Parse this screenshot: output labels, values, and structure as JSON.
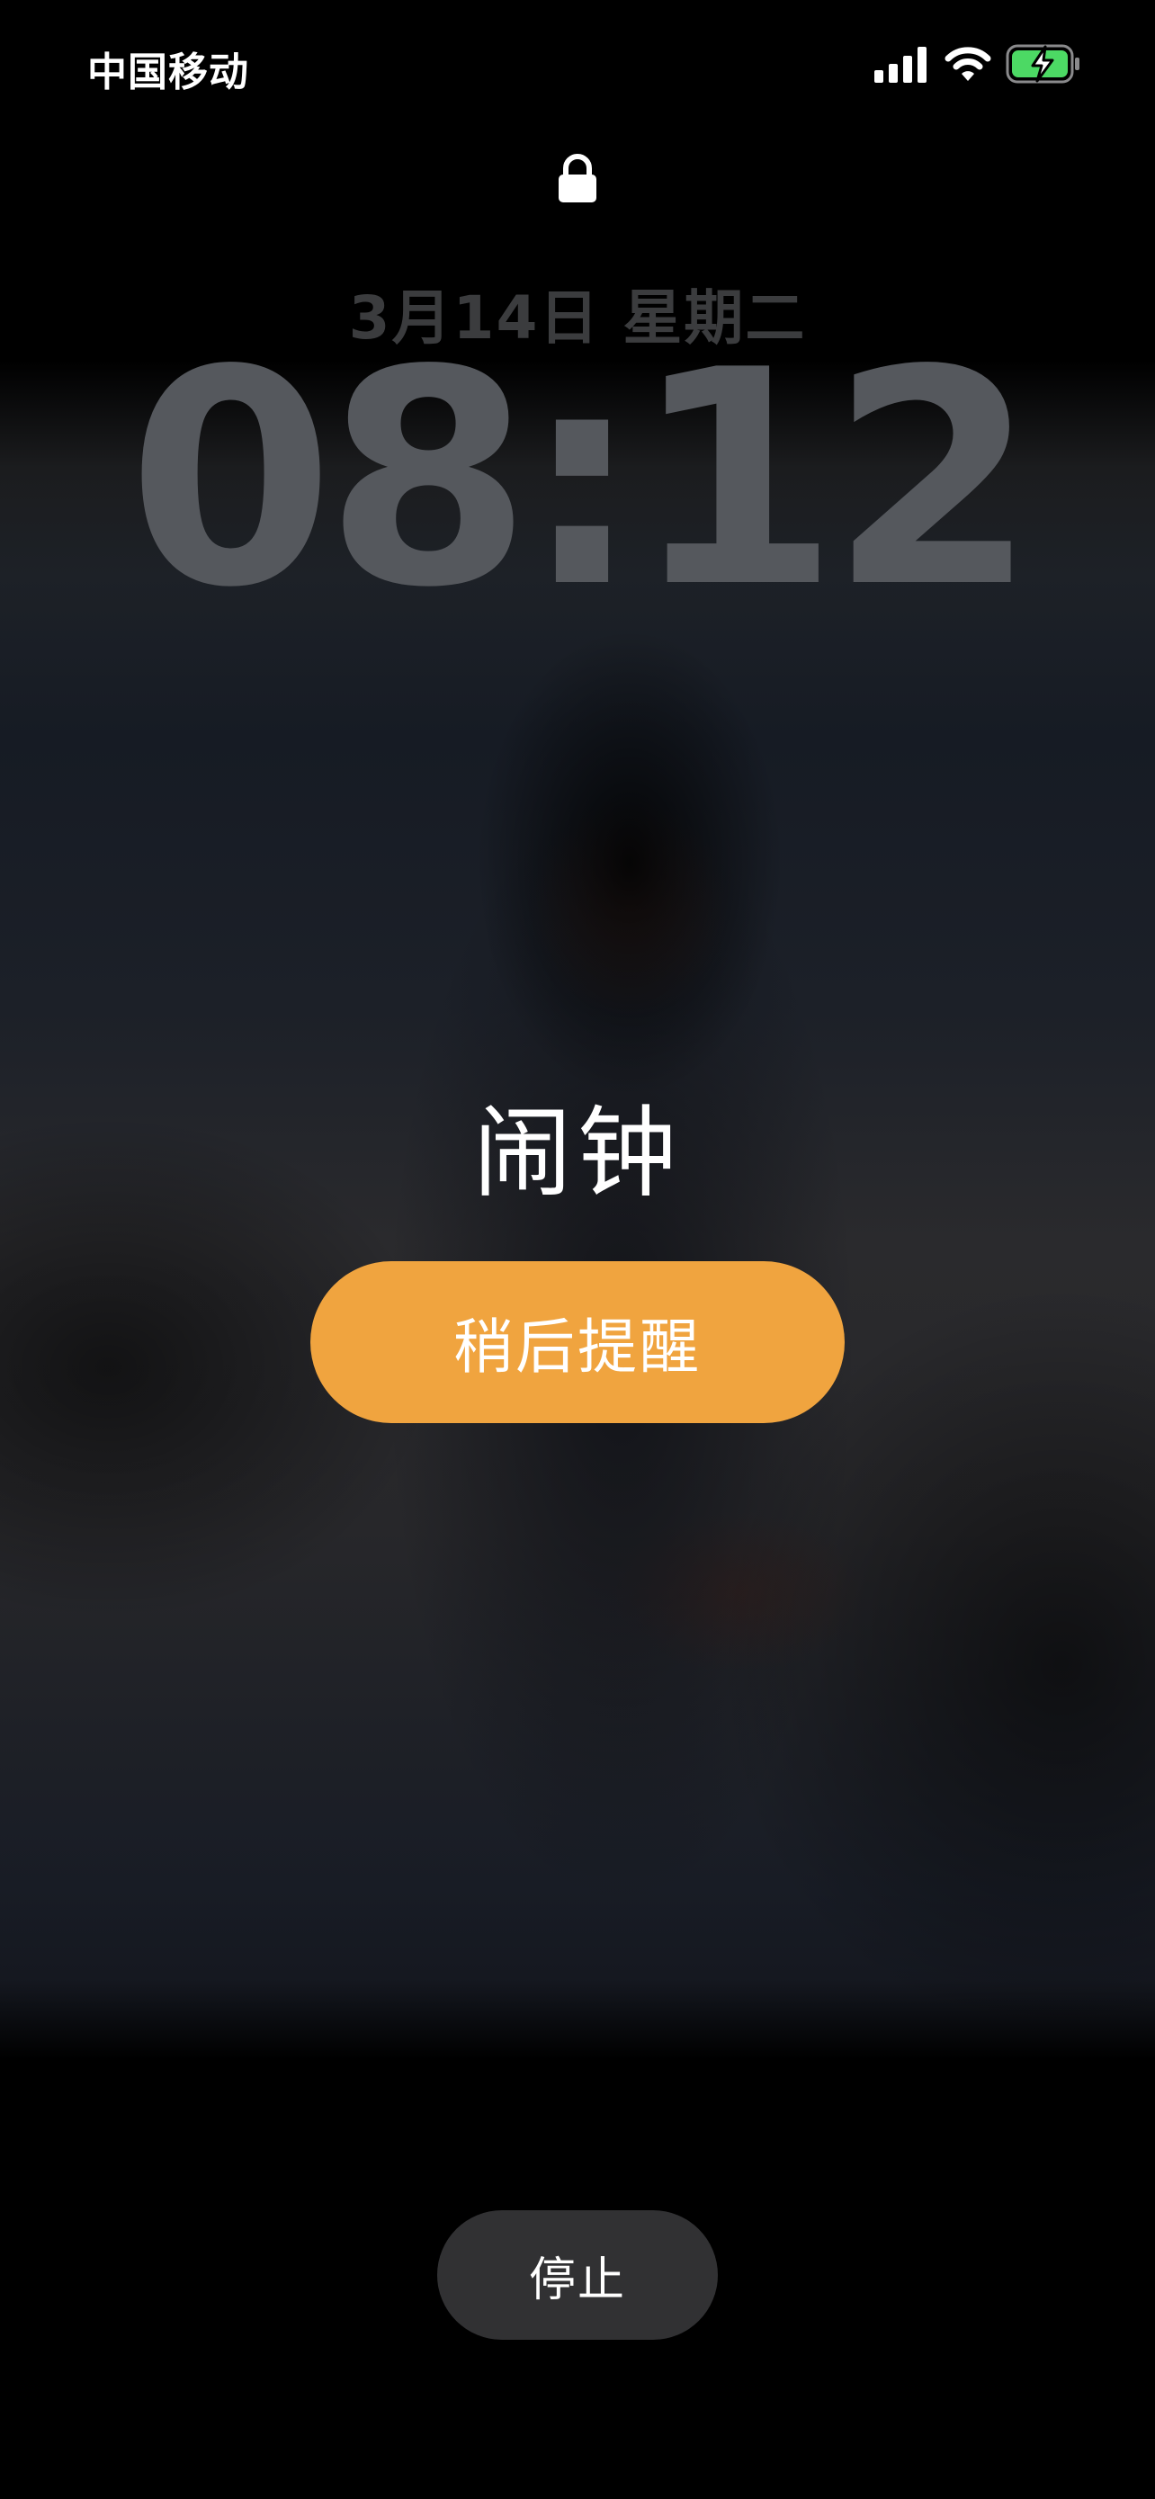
{
  "status_bar": {
    "carrier": "中国移动",
    "icons": [
      "signal-icon",
      "wifi-icon",
      "battery-charging-icon"
    ],
    "battery_color": "#4cd964"
  },
  "lock_screen": {
    "lock_icon": "lock-icon",
    "date": "3月14日 星期二",
    "time": "08:12"
  },
  "alarm": {
    "label": "闹钟",
    "snooze_label": "稍后提醒",
    "stop_label": "停止",
    "snooze_color": "#f0a43f",
    "stop_color": "#313133"
  }
}
